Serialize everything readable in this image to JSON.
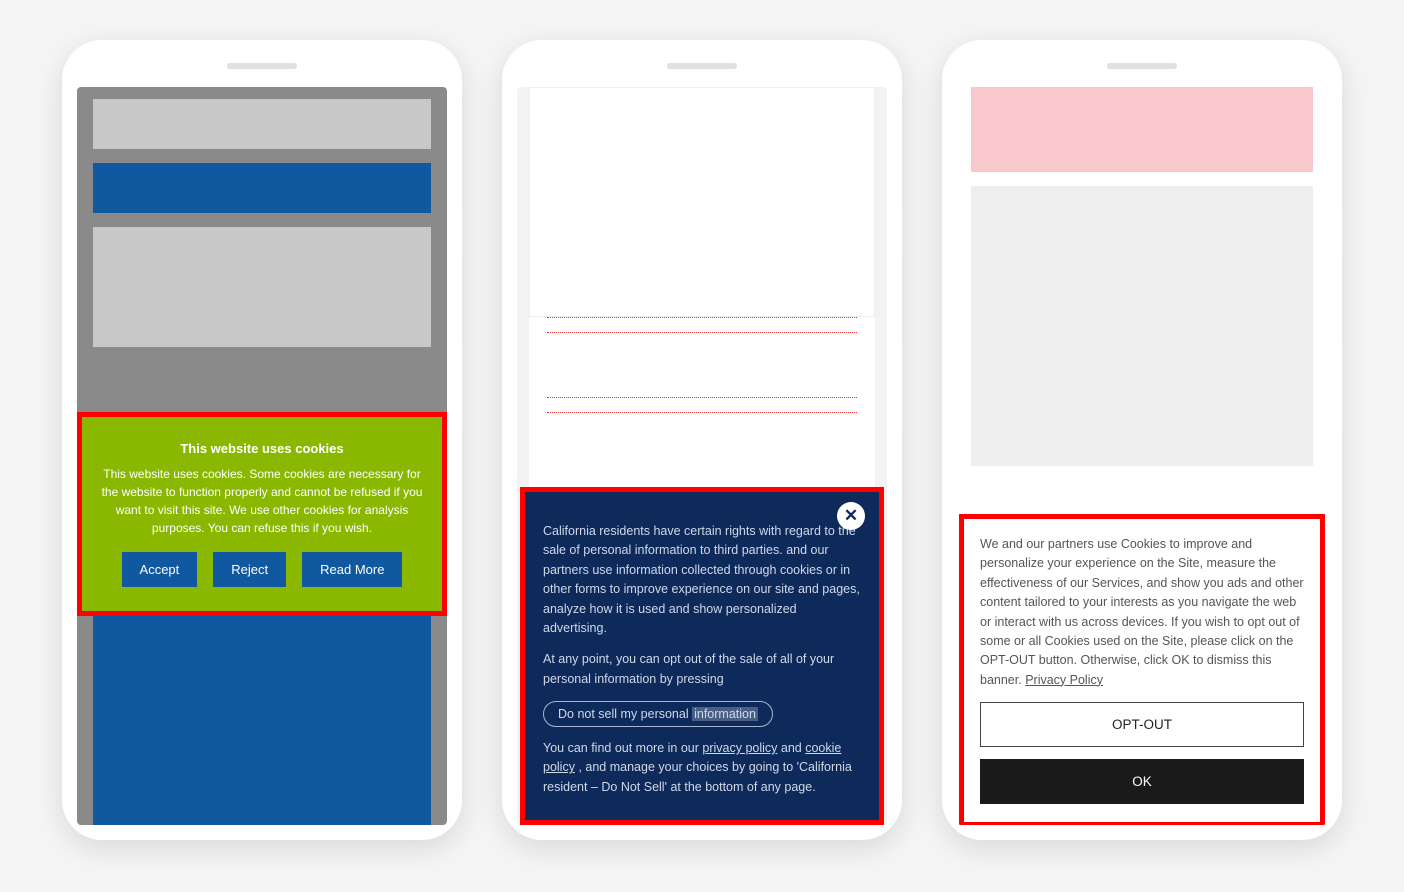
{
  "phone1": {
    "banner": {
      "title": "This website uses cookies",
      "description": "This website uses cookies. Some cookies are necessary for the website to function properly and cannot be refused if you want to visit this site. We use other cookies for analysis purposes. You can refuse this if you wish.",
      "accept": "Accept",
      "reject": "Reject",
      "read_more": "Read More"
    }
  },
  "phone2": {
    "banner": {
      "close": "✕",
      "para1_a": "California residents have certain rights with regard to the sale of personal information to third parties.",
      "para1_b": " and our partners use information collected through cookies or in other forms to improve experience on our site and pages, analyze how it is used and show personalized advertising.",
      "para2": "At any point, you can opt out of the sale of all of your personal information by pressing",
      "dnsmpi_a": "Do not sell my personal ",
      "dnsmpi_b": "information",
      "para3_a": "You can find out more in our ",
      "link_privacy": "privacy policy",
      "para3_b": " and ",
      "link_cookie": "cookie policy",
      "para3_c": ", and manage your choices by going to 'California resident – Do Not Sell' at the bottom of any page."
    }
  },
  "phone3": {
    "banner": {
      "text": "We and our partners use Cookies to improve and personalize your experience on the Site, measure the effectiveness of our Services, and show you ads and other content tailored to your interests as you navigate the web or interact with us across devices. If you wish to opt out of some or all Cookies used on the Site, please click on the OPT-OUT button. Otherwise, click OK to dismiss this banner. ",
      "link_privacy": "Privacy Policy",
      "opt_out": "OPT-OUT",
      "ok": "OK"
    }
  }
}
